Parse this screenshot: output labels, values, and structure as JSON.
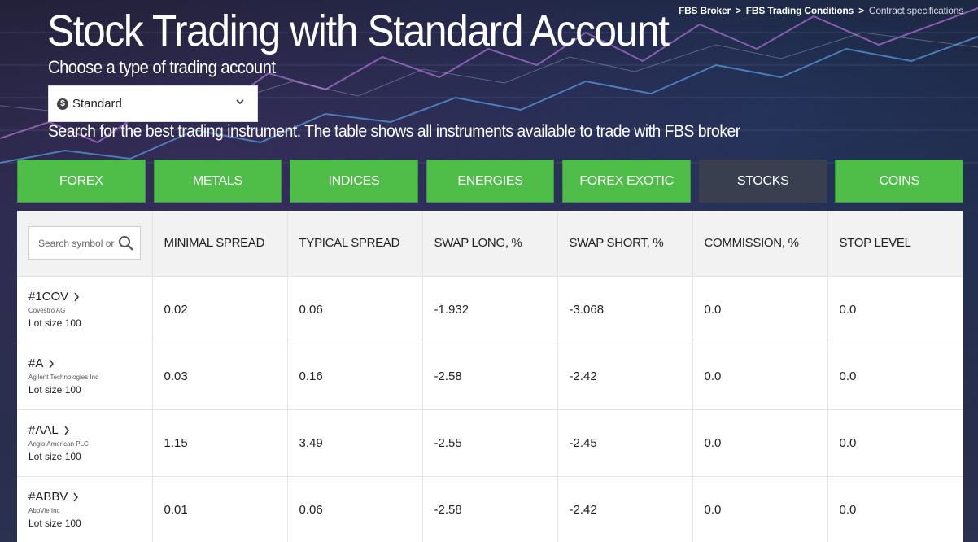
{
  "breadcrumb": {
    "items": [
      "FBS Broker",
      "FBS Trading Conditions"
    ],
    "current": "Contract specifications",
    "separator": ">"
  },
  "header": {
    "title": "Stock Trading with Standard Account",
    "subtitle": "Choose a type of trading account",
    "description": "Search for the best trading instrument. The table shows all instruments available to trade with FBS broker"
  },
  "account_select": {
    "value": "Standard",
    "icon": "dollar-coin-icon"
  },
  "tabs": [
    {
      "label": "FOREX",
      "active": false
    },
    {
      "label": "METALS",
      "active": false
    },
    {
      "label": "INDICES",
      "active": false
    },
    {
      "label": "ENERGIES",
      "active": false
    },
    {
      "label": "FOREX EXOTIC",
      "active": false
    },
    {
      "label": "STOCKS",
      "active": true
    },
    {
      "label": "COINS",
      "active": false
    }
  ],
  "search": {
    "placeholder": "Search symbol or"
  },
  "table": {
    "columns": [
      "MINIMAL SPREAD",
      "TYPICAL SPREAD",
      "SWAP LONG, %",
      "SWAP SHORT, %",
      "COMMISSION, %",
      "STOP LEVEL"
    ],
    "rows": [
      {
        "symbol": "#1COV",
        "company": "Covestro AG",
        "lot": "Lot size 100",
        "values": [
          "0.02",
          "0.06",
          "-1.932",
          "-3.068",
          "0.0",
          "0.0"
        ]
      },
      {
        "symbol": "#A",
        "company": "Agilent Technologies Inc",
        "lot": "Lot size 100",
        "values": [
          "0.03",
          "0.16",
          "-2.58",
          "-2.42",
          "0.0",
          "0.0"
        ]
      },
      {
        "symbol": "#AAL",
        "company": "Anglo American PLC",
        "lot": "Lot size 100",
        "values": [
          "1.15",
          "3.49",
          "-2.55",
          "-2.45",
          "0.0",
          "0.0"
        ]
      },
      {
        "symbol": "#ABBV",
        "company": "AbbVie Inc",
        "lot": "Lot size 100",
        "values": [
          "0.01",
          "0.06",
          "-2.58",
          "-2.42",
          "0.0",
          "0.0"
        ]
      }
    ]
  },
  "colors": {
    "tab_green": "#4fbe48",
    "tab_active": "#3a3f4f",
    "header_bg": "#f2f2f2"
  }
}
